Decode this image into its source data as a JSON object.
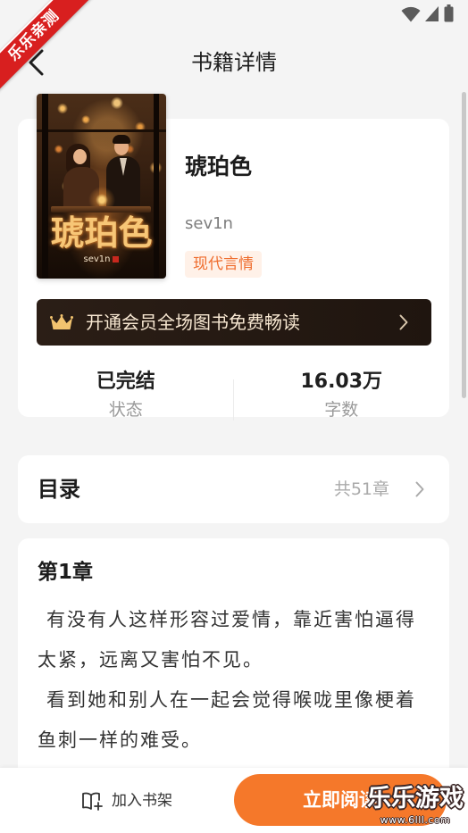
{
  "status_bar": {
    "icons": [
      "wifi-icon",
      "signal-icon",
      "battery-icon"
    ]
  },
  "header": {
    "back_icon": "back-arrow-icon",
    "title": "书籍详情"
  },
  "book": {
    "title": "琥珀色",
    "author": "sev1n",
    "tag": "现代言情",
    "cover": {
      "title": "琥珀色",
      "author": "sev1n"
    }
  },
  "vip_banner": {
    "icon": "crown-icon",
    "text": "开通会员全场图书免费畅读",
    "chevron_icon": "chevron-right-icon"
  },
  "stats": [
    {
      "value": "已完结",
      "label": "状态"
    },
    {
      "value": "16.03万",
      "label": "字数"
    }
  ],
  "catalog": {
    "label": "目录",
    "count": "共51章",
    "chevron_icon": "chevron-right-icon"
  },
  "chapter": {
    "title": "第1章",
    "paragraphs": [
      "有没有人这样形容过爱情，靠近害怕逼得太紧，远离又害怕不见。",
      "看到她和别人在一起会觉得喉咙里像梗着鱼刺一样的难受。"
    ]
  },
  "bottom_bar": {
    "shelf_icon": "add-to-shelf-icon",
    "shelf_label": "加入书架",
    "read_label": "立即阅读"
  },
  "watermarks": {
    "corner_ribbon": "乐乐亲测",
    "logo_text": "乐乐游戏",
    "logo_url": "www.6lll.com"
  },
  "colors": {
    "page_bg": "#f4f4f4",
    "accent": "#f5782a",
    "vip_bg": "#2b1e16",
    "vip_text": "#f8e8d2",
    "crown": "#f2c36f",
    "tag_text": "#ef6c2d",
    "tag_bg": "#fff1e8",
    "ribbon": "#d81f1f"
  }
}
